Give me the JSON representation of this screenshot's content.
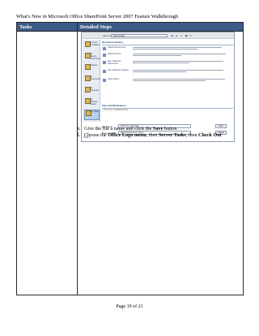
{
  "doc_title": "What's New in Microsoft Office SharePoint Server 2007 Feature Walkthrough",
  "table": {
    "col1_header": "Tasks",
    "col2_header": "Detailed Steps"
  },
  "dialog": {
    "lookin_label": "Save in:",
    "lookin_value": "Web Portals",
    "toolbar_icons": "◀ ▲ ✕ ▦ ▾",
    "places": [
      {
        "label": "Trusted Templates"
      },
      {
        "label": "My Recent Documents"
      },
      {
        "label": "Desktop"
      },
      {
        "label": "My Documents"
      },
      {
        "label": "My Computer"
      },
      {
        "label": "My Network Places"
      },
      {
        "label": "My Sites"
      }
    ],
    "libraries_header": "Document Libraries",
    "libraries": [
      {
        "name": "Shared Documents"
      },
      {
        "name": "Shared Forms"
      },
      {
        "name": "Site Collection Documents"
      },
      {
        "name": "Site Collection Images"
      },
      {
        "name": "Style Library"
      }
    ],
    "sites_header": "Sites and Workspaces",
    "sites_note": "There are no additional sites",
    "file_name_label": "File name:",
    "file_name_value": "Planning Document",
    "file_type_label": "Save as type:",
    "file_type_value": "Word Document (*.docx)",
    "save_button": "Save",
    "cancel_button": "Cancel",
    "tools_label": "Tools ▾"
  },
  "steps": {
    "e": {
      "marker": "e.",
      "text_a": "Give the file a name and click the ",
      "bold_a": "Save",
      "text_b": " button"
    },
    "f": {
      "marker": "f.",
      "text_a": "Choose the ",
      "bold_a": "Office Logo menu",
      "text_b": ", then ",
      "bold_b": "Server Tasks",
      "text_c": ", then ",
      "bold_c": "Check Out"
    }
  },
  "footer": "Page 19 of 21"
}
